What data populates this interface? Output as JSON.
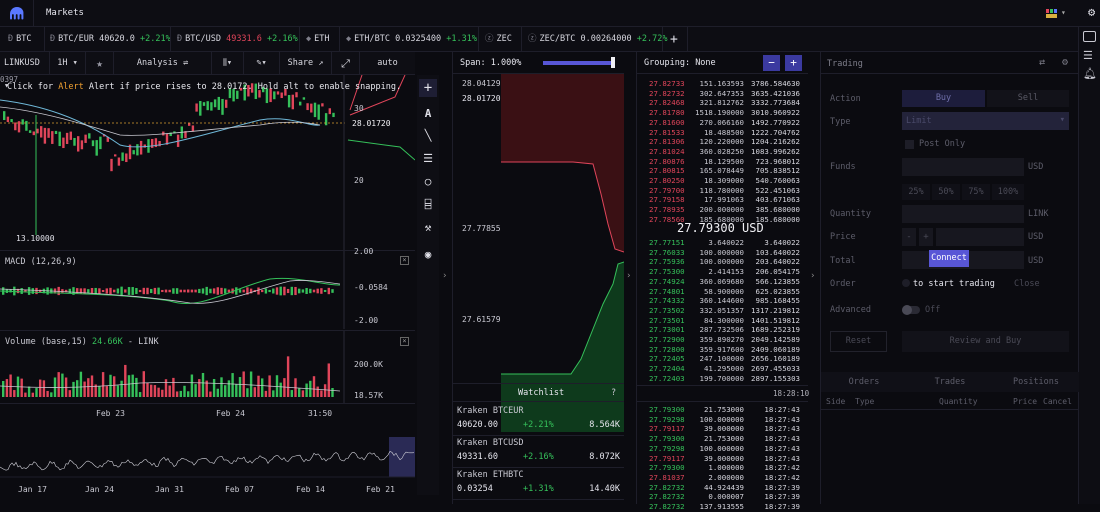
{
  "topbar": {
    "title": "Markets"
  },
  "tickers": [
    {
      "base": "BTC",
      "pair": "",
      "price": "",
      "change": ""
    },
    {
      "base": "",
      "pair": "BTC/EUR",
      "price": "40620.0",
      "change": "+2.21%"
    },
    {
      "base": "",
      "pair": "BTC/USD",
      "price": "49331.6",
      "change": "+2.16%"
    },
    {
      "base": "ETH",
      "pair": "",
      "price": "",
      "change": ""
    },
    {
      "base": "",
      "pair": "ETH/BTC",
      "price": "0.0325400",
      "change": "+1.31%"
    },
    {
      "base": "ZEC",
      "pair": "",
      "price": "",
      "change": ""
    },
    {
      "base": "",
      "pair": "ZEC/BTC",
      "price": "0.00264000",
      "change": "+2.72%"
    }
  ],
  "chart_toolbar": {
    "symbol": "LINKUSD",
    "interval": "1H",
    "analysis": "Analysis",
    "share": "Share",
    "scale": "auto"
  },
  "chart": {
    "hint_prefix": "Click for",
    "hint_alert": "Alert",
    "hint_rest": "Alert if price rises to 28.0172. Hold alt to enable snapping.",
    "corner_value": "0397",
    "low_label": "13.10000",
    "price_ticks": [
      "30",
      "28.01720",
      "20"
    ],
    "macd_title": "MACD (12,26,9)",
    "macd_ticks": [
      "2.00",
      "-0.0584",
      "-2.00"
    ],
    "volume_title": "Volume (base,15)",
    "volume_value": "24.66K",
    "volume_unit": "- LINK",
    "volume_ticks": [
      "200.0K",
      "18.57K"
    ],
    "time_labels": [
      "Feb 23",
      "Feb 24",
      "31:50"
    ],
    "nav_labels": [
      "Jan 17",
      "Jan 24",
      "Jan 31",
      "Feb 07",
      "Feb 14",
      "Feb 21"
    ]
  },
  "depth": {
    "span_label": "Span:",
    "span_value": "1.000%",
    "prices": [
      "28.04129",
      "28.01720",
      "27.77855",
      "27.61579"
    ]
  },
  "watchlist": {
    "title": "Watchlist",
    "help": "?",
    "items": [
      {
        "name": "Kraken BTCEUR",
        "price": "40620.00",
        "change": "+2.21%",
        "vol": "8.564K"
      },
      {
        "name": "Kraken BTCUSD",
        "price": "49331.60",
        "change": "+2.16%",
        "vol": "8.072K"
      },
      {
        "name": "Kraken ETHBTC",
        "price": "0.03254",
        "change": "+1.31%",
        "vol": "14.40K"
      }
    ]
  },
  "orderbook": {
    "grouping_label": "Grouping:",
    "grouping_value": "None",
    "mid_price": "27.79300 USD",
    "asks": [
      [
        "27.82733",
        "151.163593",
        "3786.584630"
      ],
      [
        "27.82732",
        "302.647353",
        "3635.421036"
      ],
      [
        "27.82468",
        "321.812762",
        "3332.773684"
      ],
      [
        "27.81780",
        "1518.190000",
        "3010.960922"
      ],
      [
        "27.81600",
        "270.066160",
        "1492.770922"
      ],
      [
        "27.81533",
        "18.488500",
        "1222.704762"
      ],
      [
        "27.81306",
        "120.220000",
        "1204.216262"
      ],
      [
        "27.81024",
        "360.028250",
        "1083.996262"
      ],
      [
        "27.80876",
        "18.129500",
        "723.968012"
      ],
      [
        "27.80815",
        "165.078449",
        "705.838512"
      ],
      [
        "27.80250",
        "18.309000",
        "540.760063"
      ],
      [
        "27.79700",
        "118.780000",
        "522.451063"
      ],
      [
        "27.79158",
        "17.991063",
        "403.671063"
      ],
      [
        "27.78935",
        "200.000000",
        "385.680000"
      ],
      [
        "27.78560",
        "185.680000",
        "185.680000"
      ]
    ],
    "bids": [
      [
        "27.77151",
        "3.640022",
        "3.640022"
      ],
      [
        "27.76033",
        "100.000000",
        "103.640022"
      ],
      [
        "27.75936",
        "100.000000",
        "203.640022"
      ],
      [
        "27.75300",
        "2.414153",
        "206.054175"
      ],
      [
        "27.74924",
        "360.069680",
        "566.123855"
      ],
      [
        "27.74801",
        "58.900000",
        "625.023855"
      ],
      [
        "27.74332",
        "360.144600",
        "985.168455"
      ],
      [
        "27.73502",
        "332.051357",
        "1317.219812"
      ],
      [
        "27.73501",
        "84.300000",
        "1401.519812"
      ],
      [
        "27.73001",
        "287.732506",
        "1689.252319"
      ],
      [
        "27.72900",
        "359.890270",
        "2049.142589"
      ],
      [
        "27.72800",
        "359.917600",
        "2409.060189"
      ],
      [
        "27.72405",
        "247.100000",
        "2656.160189"
      ],
      [
        "27.72404",
        "41.295000",
        "2697.455033"
      ],
      [
        "27.72403",
        "199.700000",
        "2897.155303"
      ]
    ],
    "book_time": "18:28:10",
    "trades": [
      [
        "27.79300",
        "21.753000",
        "18:27:43"
      ],
      [
        "27.79298",
        "100.000000",
        "18:27:43"
      ],
      [
        "27.79117",
        "39.000000",
        "18:27:43"
      ],
      [
        "27.79300",
        "21.753000",
        "18:27:43"
      ],
      [
        "27.79298",
        "100.000000",
        "18:27:43"
      ],
      [
        "27.79117",
        "39.000000",
        "18:27:43"
      ],
      [
        "27.79300",
        "1.000000",
        "18:27:42"
      ],
      [
        "27.81037",
        "2.000000",
        "18:27:42"
      ],
      [
        "27.82732",
        "44.924439",
        "18:27:39"
      ],
      [
        "27.82732",
        "0.000007",
        "18:27:39"
      ],
      [
        "27.82732",
        "137.913555",
        "18:27:39"
      ]
    ],
    "trade_sides": [
      "up",
      "up",
      "dn",
      "up",
      "up",
      "dn",
      "up",
      "dn",
      "up",
      "up",
      "up"
    ]
  },
  "trading": {
    "title": "Trading",
    "action_label": "Action",
    "buy": "Buy",
    "sell": "Sell",
    "type_label": "Type",
    "type_value": "Limit",
    "post_only": "Post Only",
    "funds_label": "Funds",
    "usd": "USD",
    "link": "LINK",
    "pcts": [
      "25%",
      "50%",
      "75%",
      "100%"
    ],
    "quantity_label": "Quantity",
    "price_label": "Price",
    "total_label": "Total",
    "connect": "Connect",
    "order_label": "Order",
    "order_text": "to start trading",
    "order_close": "Close",
    "advanced_label": "Advanced",
    "off": "Off",
    "reset": "Reset",
    "review": "Review and Buy",
    "tabs": [
      "Orders",
      "Trades",
      "Positions"
    ],
    "cols": [
      "Side",
      "Type",
      "Quantity",
      "Price",
      "Cancel"
    ]
  },
  "colors": {
    "green": "#35c05a",
    "red": "#e0455a",
    "accent": "#5856d6"
  }
}
